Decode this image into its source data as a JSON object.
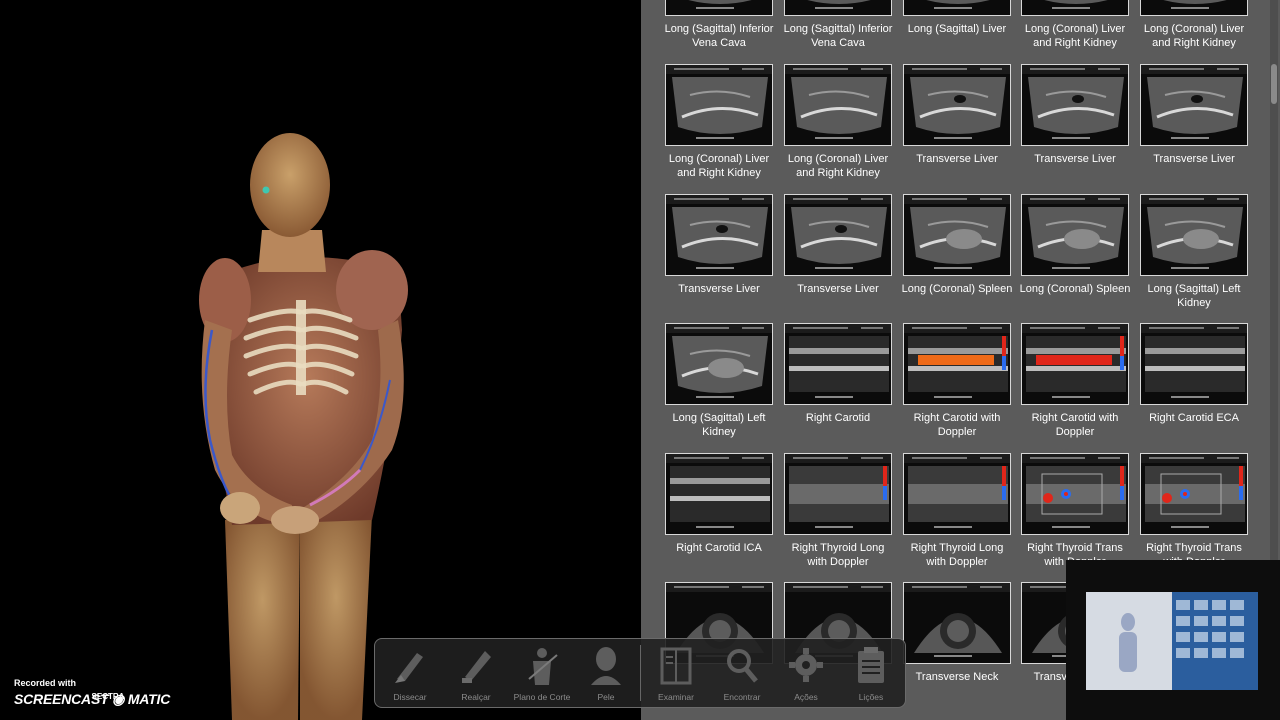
{
  "gallery": {
    "captions": [
      [
        "Long (Sagittal) Inferior Vena Cava",
        "Long (Sagittal) Inferior Vena Cava",
        "Long (Sagittal) Liver",
        "Long (Coronal) Liver and Right Kidney",
        "Long (Coronal) Liver and Right Kidney"
      ],
      [
        "Long (Coronal) Liver and Right Kidney",
        "Long (Coronal) Liver and Right Kidney",
        "Transverse Liver",
        "Transverse Liver",
        "Transverse Liver"
      ],
      [
        "Transverse Liver",
        "Transverse Liver",
        "Long (Coronal) Spleen",
        "Long (Coronal) Spleen",
        "Long (Sagittal) Left Kidney"
      ],
      [
        "Long (Sagittal) Left Kidney",
        "Right Carotid",
        "Right Carotid with Doppler",
        "Right Carotid with Doppler",
        "Right Carotid ECA"
      ],
      [
        "Right Carotid ICA",
        "Right Thyroid Long with Doppler",
        "Right Thyroid Long with Doppler",
        "Right Thyroid Trans with Doppler",
        "Right Thyroid Trans with Doppler"
      ],
      [
        "",
        "",
        "Transverse Neck",
        "Transverse Neck",
        ""
      ]
    ]
  },
  "toolbar": {
    "items": [
      {
        "label": "Dissecar",
        "icon": "scalpel-icon"
      },
      {
        "label": "Realçar",
        "icon": "highlighter-icon"
      },
      {
        "label": "Plano de Corte",
        "icon": "cutting-plane-icon"
      },
      {
        "label": "Pele",
        "icon": "skin-head-icon"
      },
      {
        "label": "Examinar",
        "icon": "examine-book-icon"
      },
      {
        "label": "Encontrar",
        "icon": "magnifier-icon"
      },
      {
        "label": "Ações",
        "icon": "gear-icon"
      },
      {
        "label": "Lições",
        "icon": "lessons-notepad-icon"
      }
    ]
  },
  "watermark": {
    "line1": "Recorded with",
    "line2": "SCREENCAST ◉ MATIC"
  },
  "camera": {
    "brand": "SECTRA"
  },
  "colors": {
    "gallery_bg": "#5b5b5b",
    "toolbar_bg": "#202020",
    "doppler_red": "#e0261a",
    "doppler_orange": "#ee6a18",
    "doppler_blue": "#2a6cf0"
  }
}
